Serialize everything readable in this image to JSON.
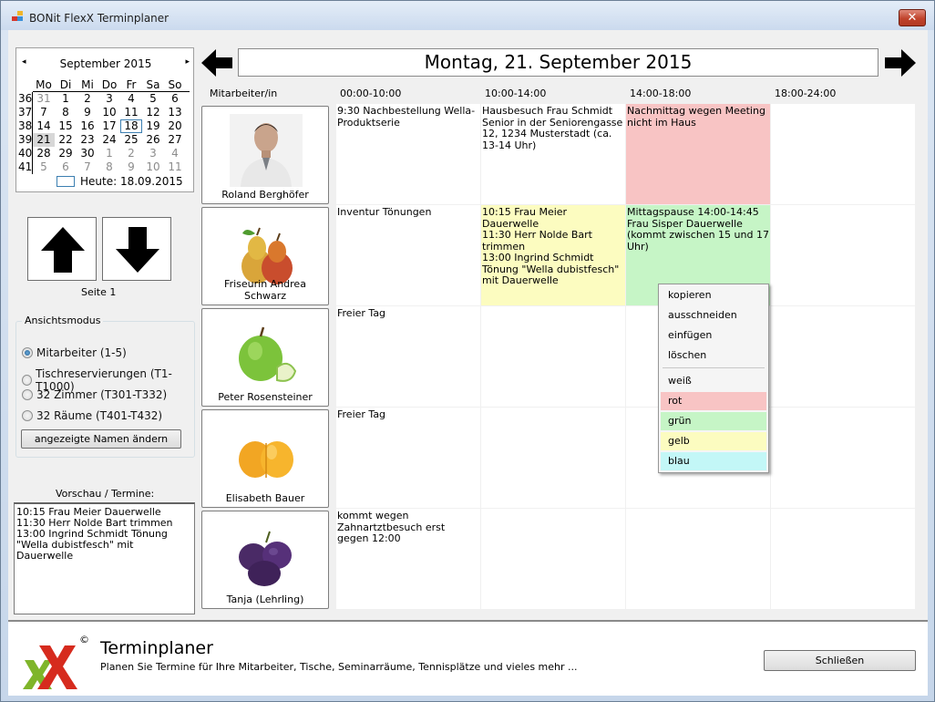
{
  "window": {
    "title": "BONit FlexX Terminplaner",
    "close_glyph": "✕"
  },
  "calendar": {
    "month_title": "September 2015",
    "prev_glyph": "◂",
    "next_glyph": "▸",
    "day_headers": [
      "Mo",
      "Di",
      "Mi",
      "Do",
      "Fr",
      "Sa",
      "So"
    ],
    "weeks": [
      {
        "wk": "36",
        "days": [
          "31",
          "1",
          "2",
          "3",
          "4",
          "5",
          "6"
        ]
      },
      {
        "wk": "37",
        "days": [
          "7",
          "8",
          "9",
          "10",
          "11",
          "12",
          "13"
        ]
      },
      {
        "wk": "38",
        "days": [
          "14",
          "15",
          "16",
          "17",
          "18",
          "19",
          "20"
        ]
      },
      {
        "wk": "39",
        "days": [
          "21",
          "22",
          "23",
          "24",
          "25",
          "26",
          "27"
        ]
      },
      {
        "wk": "40",
        "days": [
          "28",
          "29",
          "30",
          "1",
          "2",
          "3",
          "4"
        ]
      },
      {
        "wk": "41",
        "days": [
          "5",
          "6",
          "7",
          "8",
          "9",
          "10",
          "11"
        ]
      }
    ],
    "today_label": "Heute: 18.09.2015"
  },
  "paging": {
    "up_label": "up-arrow-icon",
    "down_label": "down-arrow-icon",
    "page_label": "Seite 1"
  },
  "view_mode": {
    "title": "Ansichtsmodus",
    "options": [
      {
        "label": "Mitarbeiter (1-5)",
        "selected": true
      },
      {
        "label": "Tischreservierungen (T1-T1000)",
        "selected": false
      },
      {
        "label": "32 Zimmer (T301-T332)",
        "selected": false
      },
      {
        "label": "32 Räume (T401-T432)",
        "selected": false
      }
    ],
    "rename_button": "angezeigte Namen ändern"
  },
  "preview": {
    "label": "Vorschau / Termine:",
    "text": "10:15 Frau Meier Dauerwelle\n11:30 Herr Nolde Bart trimmen\n13:00 Ingrind Schmidt Tönung \"Wella dubistfesch\" mit Dauerwelle"
  },
  "header": {
    "date": "Montag, 21. September 2015",
    "column_staff": "Mitarbeiter/in",
    "slots": [
      "00:00-10:00",
      "10:00-14:00",
      "14:00-18:00",
      "18:00-24:00"
    ]
  },
  "staff": [
    {
      "name": "Roland Berghöfer",
      "icon": "person-photo-icon"
    },
    {
      "name": "Friseurin Andrea Schwarz",
      "icon": "pears-icon"
    },
    {
      "name": "Peter Rosensteiner",
      "icon": "green-apple-icon"
    },
    {
      "name": "Elisabeth Bauer",
      "icon": "apricots-icon"
    },
    {
      "name": "Tanja (Lehrling)",
      "icon": "plums-icon"
    }
  ],
  "appointments": [
    [
      "9:30 Nachbestellung Wella-Produktserie",
      "Hausbesuch Frau Schmidt Senior in der Seniorengasse 12, 1234 Musterstadt (ca. 13-14 Uhr)",
      "Nachmittag wegen Meeting nicht im Haus",
      ""
    ],
    [
      "Inventur Tönungen",
      "10:15 Frau Meier Dauerwelle\n11:30 Herr Nolde Bart trimmen\n13:00 Ingrind Schmidt Tönung \"Wella dubistfesch\" mit Dauerwelle",
      "Mittagspause 14:00-14:45\nFrau Sisper Dauerwelle\n(kommt zwischen 15 und 17 Uhr)",
      ""
    ],
    [
      "Freier Tag",
      "",
      "",
      ""
    ],
    [
      "Freier Tag",
      "",
      "",
      ""
    ],
    [
      "kommt wegen Zahnartztbesuch erst gegen 12:00",
      "",
      "",
      ""
    ]
  ],
  "cell_colors": [
    [
      "#ffffff",
      "#ffffff",
      "#f8c4c4",
      "#ffffff"
    ],
    [
      "#ffffff",
      "#fcfcc0",
      "#c6f5c6",
      "#ffffff"
    ],
    [
      "#ffffff",
      "#ffffff",
      "#ffffff",
      "#ffffff"
    ],
    [
      "#ffffff",
      "#ffffff",
      "#ffffff",
      "#ffffff"
    ],
    [
      "#ffffff",
      "#ffffff",
      "#ffffff",
      "#ffffff"
    ]
  ],
  "context_menu": {
    "items": [
      {
        "label": "kopieren",
        "color": ""
      },
      {
        "label": "ausschneiden",
        "color": ""
      },
      {
        "label": "einfügen",
        "color": ""
      },
      {
        "label": "löschen",
        "color": ""
      },
      {
        "label": "weiß",
        "color": "#f5f5f5"
      },
      {
        "label": "rot",
        "color": "#f8c4c4"
      },
      {
        "label": "grün",
        "color": "#c6f5c6"
      },
      {
        "label": "gelb",
        "color": "#fcfcc0"
      },
      {
        "label": "blau",
        "color": "#c3f7f7"
      }
    ]
  },
  "footer": {
    "logo_mark": "©",
    "title": "Terminplaner",
    "subtitle": "Planen Sie Termine für Ihre Mitarbeiter, Tische, Seminarräume, Tennisplätze und vieles mehr ...",
    "close_button": "Schließen"
  }
}
